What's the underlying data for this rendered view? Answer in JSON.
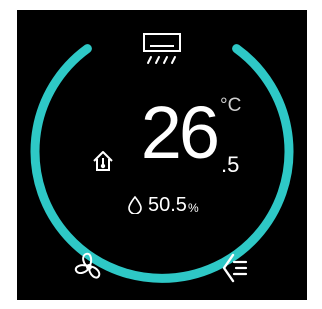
{
  "thermostat": {
    "temperature_int": "26",
    "temperature_dec": ".5",
    "temperature_unit": "°C",
    "humidity_value": "50.5",
    "humidity_unit": "%"
  },
  "icons": {
    "top": "air-conditioner-icon",
    "left": "indoor-temperature-house-icon",
    "humidity": "water-drop-icon",
    "bottom_left": "fan-icon",
    "bottom_right": "mode-icon"
  },
  "colors": {
    "ring": "#2ec8c6",
    "background": "#000000",
    "text": "#ffffff"
  }
}
